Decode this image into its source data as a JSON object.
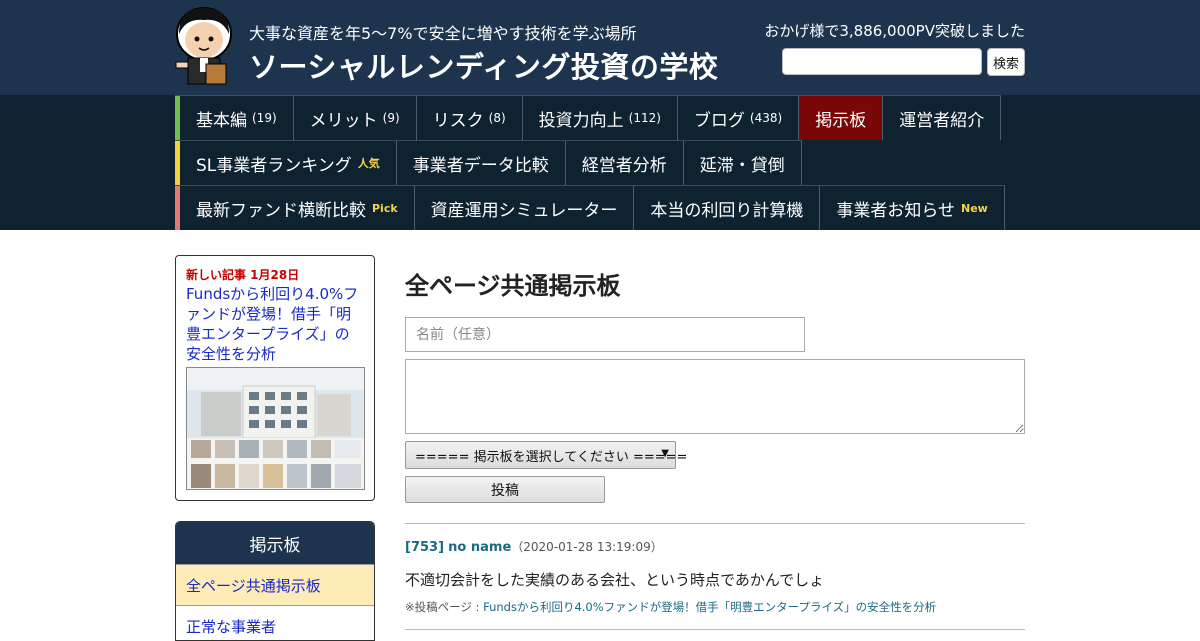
{
  "header": {
    "tagline": "大事な資産を年5～7%で安全に増やす技術を学ぶ場所",
    "site_title": "ソーシャルレンディング投資の学校",
    "pv_text": "おかげ様で3,886,000PV突破しました",
    "search_button": "検索",
    "bg_color": "#1d334e"
  },
  "nav": {
    "rows": [
      {
        "accent_color": "#6fbf4a",
        "items": [
          {
            "label": "基本編",
            "count": "(19)"
          },
          {
            "label": "メリット",
            "count": "(9)"
          },
          {
            "label": "リスク",
            "count": "(8)"
          },
          {
            "label": "投資力向上",
            "count": "(112)"
          },
          {
            "label": "ブログ",
            "count": "(438)"
          },
          {
            "label": "掲示板",
            "count": "",
            "active": true
          },
          {
            "label": "運営者紹介",
            "count": ""
          }
        ]
      },
      {
        "accent_color": "#f0d040",
        "items": [
          {
            "label": "SL事業者ランキング",
            "badge": "人気"
          },
          {
            "label": "事業者データ比較",
            "badge": ""
          },
          {
            "label": "経営者分析",
            "badge": ""
          },
          {
            "label": "延滞・貸倒",
            "badge": ""
          }
        ]
      },
      {
        "accent_color": "#e07a7a",
        "items": [
          {
            "label": "最新ファンド横断比較",
            "badge": "Pick"
          },
          {
            "label": "資産運用シミュレーター",
            "badge": ""
          },
          {
            "label": "本当の利回り計算機",
            "badge": ""
          },
          {
            "label": "事業者お知らせ",
            "badge": "New"
          }
        ]
      }
    ],
    "active_color": "#7a0707"
  },
  "sidebar": {
    "new_label": "新しい記事 1月28日",
    "new_article": "Fundsから利回り4.0%ファンドが登場！借手「明豊エンタープライズ」の安全性を分析",
    "board_heading": "掲示板",
    "board_items": [
      {
        "label": "全ページ共通掲示板",
        "selected": true
      },
      {
        "label": "正常な事業者",
        "selected": false
      }
    ]
  },
  "main": {
    "title": "全ページ共通掲示板",
    "name_placeholder": "名前（任意）",
    "select_value": "===== 掲示板を選択してください =====",
    "submit_label": "投稿",
    "post": {
      "number": "[753]",
      "name": "no name",
      "date": "（2020-01-28 13:19:09）",
      "body": "不適切会計をした実績のある会社、という時点であかんでしょ",
      "source_prefix": "※投稿ページ : ",
      "source_link": "Fundsから利回り4.0%ファンドが登場！借手「明豊エンタープライズ」の安全性を分析"
    }
  }
}
